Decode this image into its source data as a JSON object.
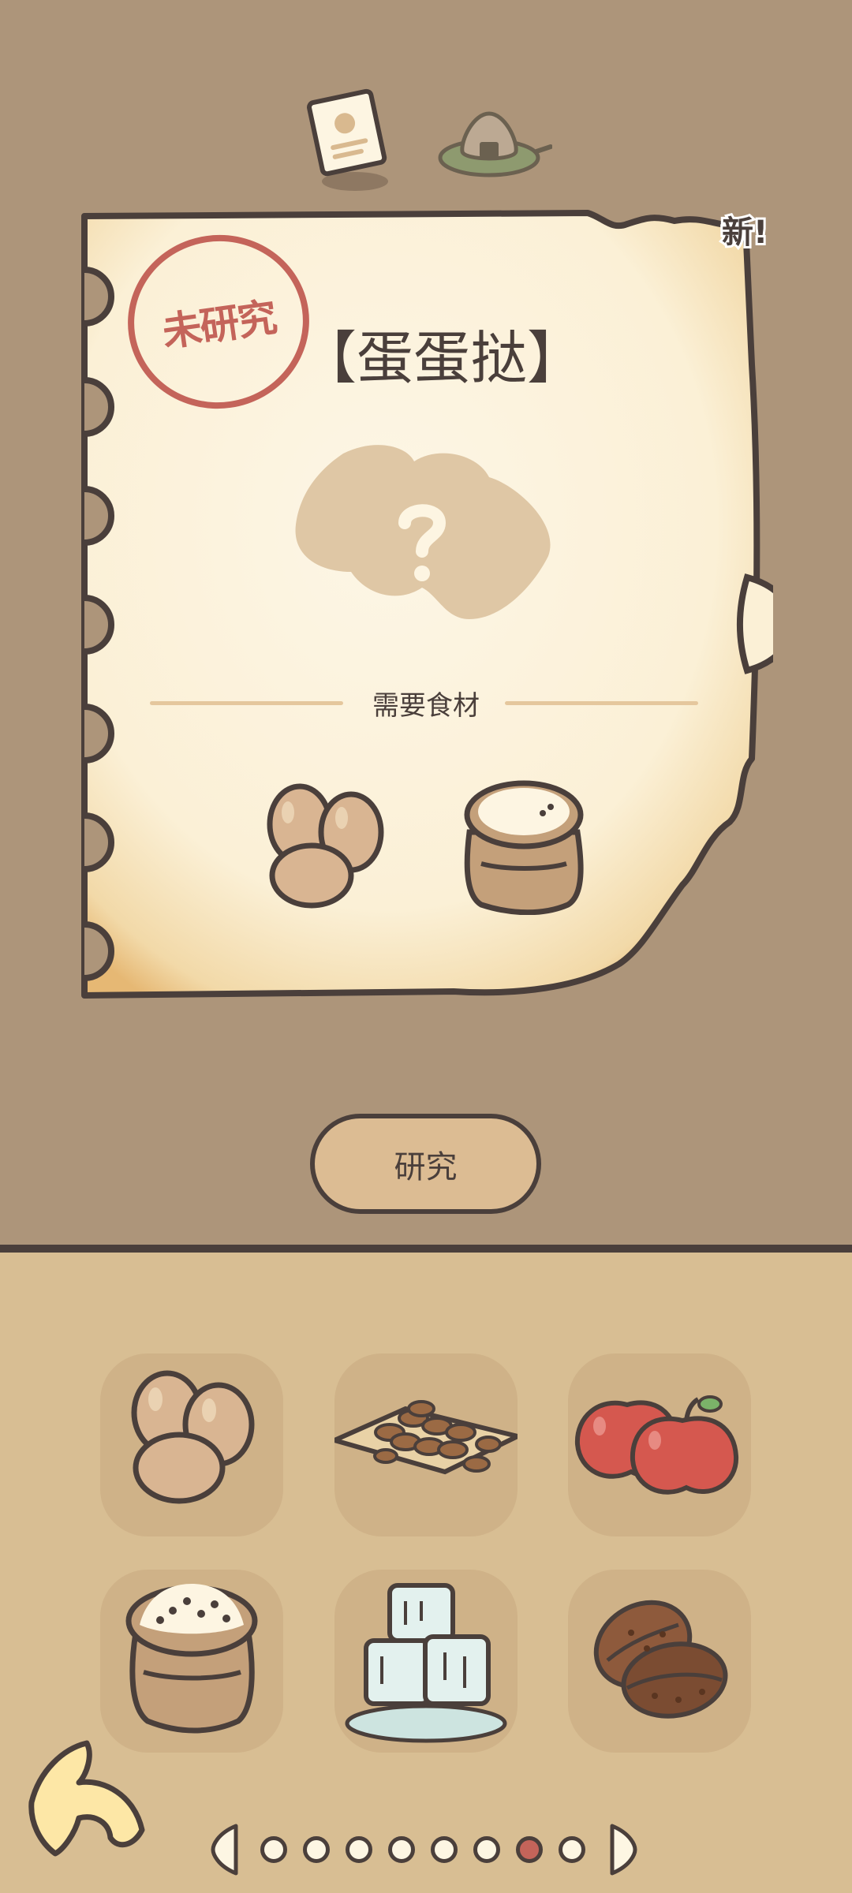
{
  "header": {
    "recipe_note_icon": "recipe-note-icon",
    "onigiri_icon": "onigiri-plate-icon"
  },
  "recipe": {
    "new_badge": "新!",
    "stamp": "未研究",
    "title": "【蛋蛋挞】",
    "mystery_icon": "question-blob-icon",
    "ingredients_label": "需要食材",
    "required_ingredients": [
      "egg-icon",
      "flour-sack-icon"
    ]
  },
  "actions": {
    "research_label": "研究"
  },
  "pantry": {
    "items": [
      "egg-icon",
      "almonds-icon",
      "apples-icon",
      "flour-sack-icon",
      "ice-cubes-icon",
      "coffee-beans-icon"
    ]
  },
  "pager": {
    "page_count": 8,
    "current_page": 7
  },
  "colors": {
    "background_top": "#ad957a",
    "background_bottom": "#d8be93",
    "paper": "#fdf5e2",
    "outline": "#4a3f3b",
    "stamp_red": "#c4645a",
    "slot": "#cfb288",
    "button": "#dcbc93"
  }
}
